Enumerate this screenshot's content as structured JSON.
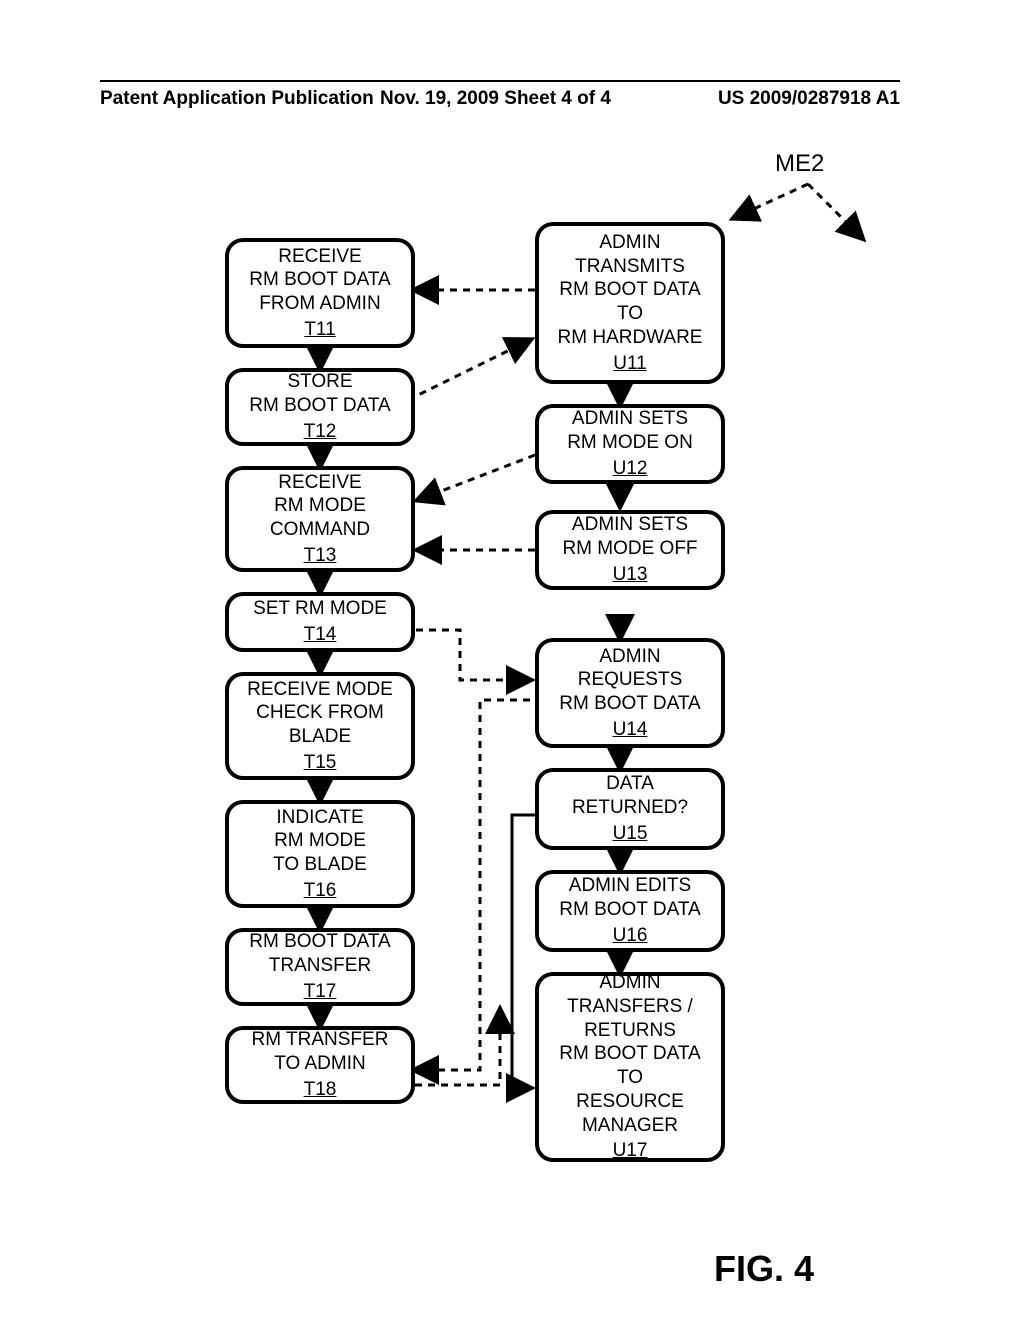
{
  "header": {
    "left": "Patent Application Publication",
    "center": "Nov. 19, 2009  Sheet 4 of 4",
    "right": "US 2009/0287918 A1"
  },
  "me2": "ME2",
  "left": {
    "t11": {
      "text": "RECEIVE\nRM BOOT DATA\nFROM ADMIN",
      "ref": "T11"
    },
    "t12": {
      "text": "STORE\nRM BOOT DATA",
      "ref": "T12"
    },
    "t13": {
      "text": "RECEIVE\nRM MODE\nCOMMAND",
      "ref": "T13"
    },
    "t14": {
      "text": "SET RM MODE",
      "ref": "T14"
    },
    "t15": {
      "text": "RECEIVE MODE\nCHECK FROM\nBLADE",
      "ref": "T15"
    },
    "t16": {
      "text": "INDICATE\nRM MODE\nTO BLADE",
      "ref": "T16"
    },
    "t17": {
      "text": "RM BOOT DATA\nTRANSFER",
      "ref": "T17"
    },
    "t18": {
      "text": "RM TRANSFER\nTO ADMIN",
      "ref": "T18"
    }
  },
  "right": {
    "u11": {
      "text": "ADMIN\nTRANSMITS\nRM BOOT DATA\nTO\nRM HARDWARE",
      "ref": "U11"
    },
    "u12": {
      "text": "ADMIN SETS\nRM MODE ON",
      "ref": "U12"
    },
    "u13": {
      "text": "ADMIN SETS\nRM MODE OFF",
      "ref": "U13"
    },
    "u14": {
      "text": "ADMIN\nREQUESTS\nRM BOOT DATA",
      "ref": "U14"
    },
    "u15": {
      "text": "DATA\nRETURNED?",
      "ref": "U15"
    },
    "u16": {
      "text": "ADMIN EDITS\nRM BOOT DATA",
      "ref": "U16"
    },
    "u17": {
      "text": "ADMIN\nTRANSFERS /\nRETURNS\nRM BOOT DATA\nTO\nRESOURCE\nMANAGER",
      "ref": "U17"
    }
  },
  "fig": "FIG. 4"
}
